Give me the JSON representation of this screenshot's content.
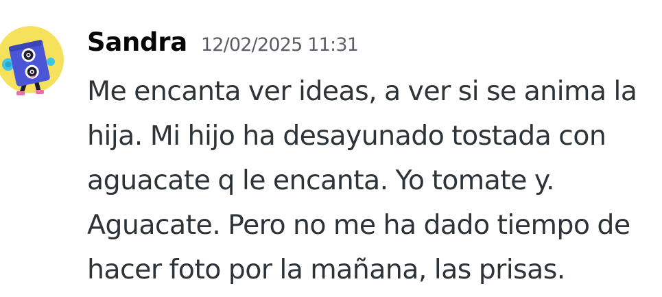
{
  "message": {
    "author": "Sandra",
    "timestamp": "12/02/2025 11:31",
    "content": "Me encanta ver ideas, a ver si se anima la hija. Mi hijo ha desayunado tostada con aguacate q le encanta. Yo tomate y. Aguacate. Pero no me ha dado tiempo de hacer foto por la mañana, las prisas."
  },
  "avatar": {
    "icon": "robot-avatar-icon",
    "background_color": "#f5e15b",
    "body_color": "#4a56d6"
  },
  "colors": {
    "username": "#060607",
    "timestamp": "#5c5e66",
    "text": "#2e3338",
    "background": "#ffffff"
  }
}
